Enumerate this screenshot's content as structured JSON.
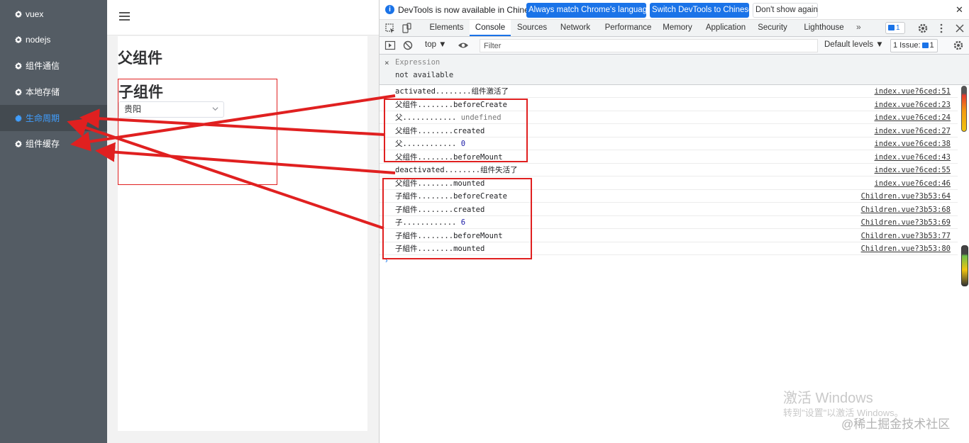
{
  "sidebar": {
    "items": [
      {
        "label": "vuex",
        "active": false
      },
      {
        "label": "nodejs",
        "active": false
      },
      {
        "label": "组件通信",
        "active": false
      },
      {
        "label": "本地存储",
        "active": false
      },
      {
        "label": "生命周期",
        "active": true
      },
      {
        "label": "组件缓存",
        "active": false
      }
    ],
    "icon": "gear-icon",
    "bg_color": "#545c64",
    "active_color": "#409eff"
  },
  "app": {
    "menu_icon": "hamburger-icon",
    "parent_title": "父组件",
    "child_title": "子组件",
    "select_value": "贵阳"
  },
  "devtools": {
    "banner": {
      "text": "DevTools is now available in Chinese!",
      "btn_always": "Always match Chrome's language",
      "btn_switch": "Switch DevTools to Chinese",
      "btn_dont": "Don't show again",
      "close": "✕"
    },
    "tabs": [
      "Elements",
      "Console",
      "Sources",
      "Network",
      "Performance",
      "Memory",
      "Application",
      "Security",
      "Lighthouse"
    ],
    "active_tab": "Console",
    "more": "»",
    "messages_count": "1",
    "console_bar": {
      "context": "top ▼",
      "filter_placeholder": "Filter",
      "levels": "Default levels ▼",
      "issues_label": "1 Issue:",
      "issues_count": "1"
    },
    "live_expression": {
      "close": "×",
      "label": "Expression",
      "value": "not available"
    },
    "logs": [
      {
        "msg": "activated........组件激活了",
        "src": "index.vue?6ced:51"
      },
      {
        "msg": "父组件........beforeCreate",
        "src": "index.vue?6ced:23"
      },
      {
        "msg": "父............",
        "value": "undefined",
        "vtype": "undef",
        "src": "index.vue?6ced:24"
      },
      {
        "msg": "父组件........created",
        "src": "index.vue?6ced:27"
      },
      {
        "msg": "父............",
        "value": "0",
        "vtype": "num",
        "src": "index.vue?6ced:38"
      },
      {
        "msg": "父组件........beforeMount",
        "src": "index.vue?6ced:43"
      },
      {
        "msg": "deactivated........组件失活了",
        "src": "index.vue?6ced:55"
      },
      {
        "msg": "父组件........mounted",
        "src": "index.vue?6ced:46"
      },
      {
        "msg": "子組件........beforeCreate",
        "src": "Children.vue?3b53:64"
      },
      {
        "msg": "子組件........created",
        "src": "Children.vue?3b53:68"
      },
      {
        "msg": "子............",
        "value": "6",
        "vtype": "num",
        "src": "Children.vue?3b53:69"
      },
      {
        "msg": "子組件........beforeMount",
        "src": "Children.vue?3b53:77"
      },
      {
        "msg": "子組件........mounted",
        "src": "Children.vue?3b53:80"
      }
    ],
    "prompt": "›"
  },
  "watermark": {
    "line1": "激活 Windows",
    "line2": "转到\"设置\"以激活 Windows。",
    "line3": "@稀土掘金技术社区"
  },
  "annotation_color": "#e02020"
}
